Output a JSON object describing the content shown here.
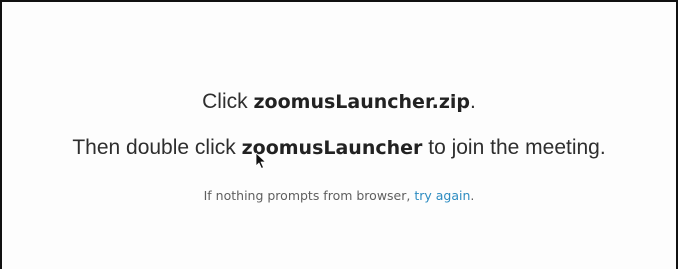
{
  "instructions": {
    "line1": {
      "prefix": "Click ",
      "filename": "zoomusLauncher.zip",
      "suffix": "."
    },
    "line2": {
      "prefix": "Then double click ",
      "app_name": "zoomusLauncher",
      "suffix": " to join the meeting."
    },
    "retry": {
      "text": "If nothing prompts from browser, ",
      "link_label": "try again",
      "suffix": "."
    }
  },
  "colors": {
    "link": "#2d8cc1",
    "text": "#2e2e2e",
    "muted_text": "#5f5f5f"
  },
  "icons": {
    "cursor": "mouse-pointer-icon"
  }
}
